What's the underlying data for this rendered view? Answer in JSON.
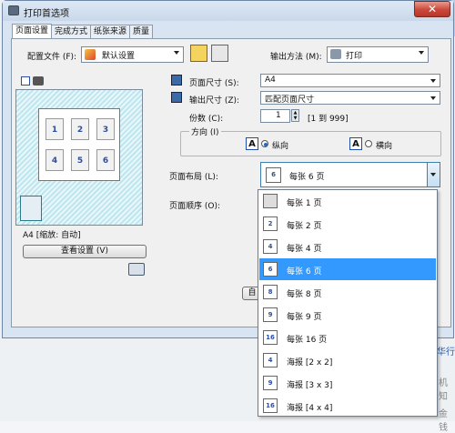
{
  "window": {
    "title": "打印首选项",
    "close_glyph": "✕"
  },
  "tabs": [
    "页面设置",
    "完成方式",
    "纸张来源",
    "质量"
  ],
  "config": {
    "label": "配置文件 (F):",
    "value": "默认设置"
  },
  "output_method": {
    "label": "输出方法 (M):",
    "value": "打印"
  },
  "page_size": {
    "label": "页面尺寸 (S):",
    "value": "A4"
  },
  "output_size": {
    "label": "输出尺寸 (Z):",
    "value": "匹配页面尺寸"
  },
  "copies": {
    "label": "份数 (C):",
    "value": "1",
    "range": "[1 到 999]"
  },
  "orientation": {
    "label": "方向 (I)",
    "portrait": "纵向",
    "landscape": "横向",
    "icon_letter": "A"
  },
  "layout": {
    "label": "页面布局 (L):",
    "value": "每张 6 页",
    "icon_text": "6"
  },
  "order": {
    "label": "页面顺序 (O):"
  },
  "preview": {
    "caption": "A4 [缩放: 自动]",
    "cells": [
      "1",
      "2",
      "3",
      "4",
      "5",
      "6"
    ]
  },
  "buttons": {
    "view_settings": "查看设置 (V)",
    "partial": "自"
  },
  "dropdown_items": [
    {
      "icon": "",
      "label": "每张 1 页",
      "selected": false
    },
    {
      "icon": "2",
      "label": "每张 2 页",
      "selected": false
    },
    {
      "icon": "4",
      "label": "每张 4 页",
      "selected": false
    },
    {
      "icon": "6",
      "label": "每张 6 页",
      "selected": true
    },
    {
      "icon": "8",
      "label": "每张 8 页",
      "selected": false
    },
    {
      "icon": "9",
      "label": "每张 9 页",
      "selected": false
    },
    {
      "icon": "16",
      "label": "每张 16 页",
      "selected": false
    },
    {
      "icon": "4",
      "label": "海报 [2 x 2]",
      "selected": false
    },
    {
      "icon": "9",
      "label": "海报 [3 x 3]",
      "selected": false
    },
    {
      "icon": "16",
      "label": "海报 [4 x 4]",
      "selected": false
    }
  ],
  "background": {
    "fragments": [
      "华行",
      "机知",
      "金钱"
    ]
  }
}
